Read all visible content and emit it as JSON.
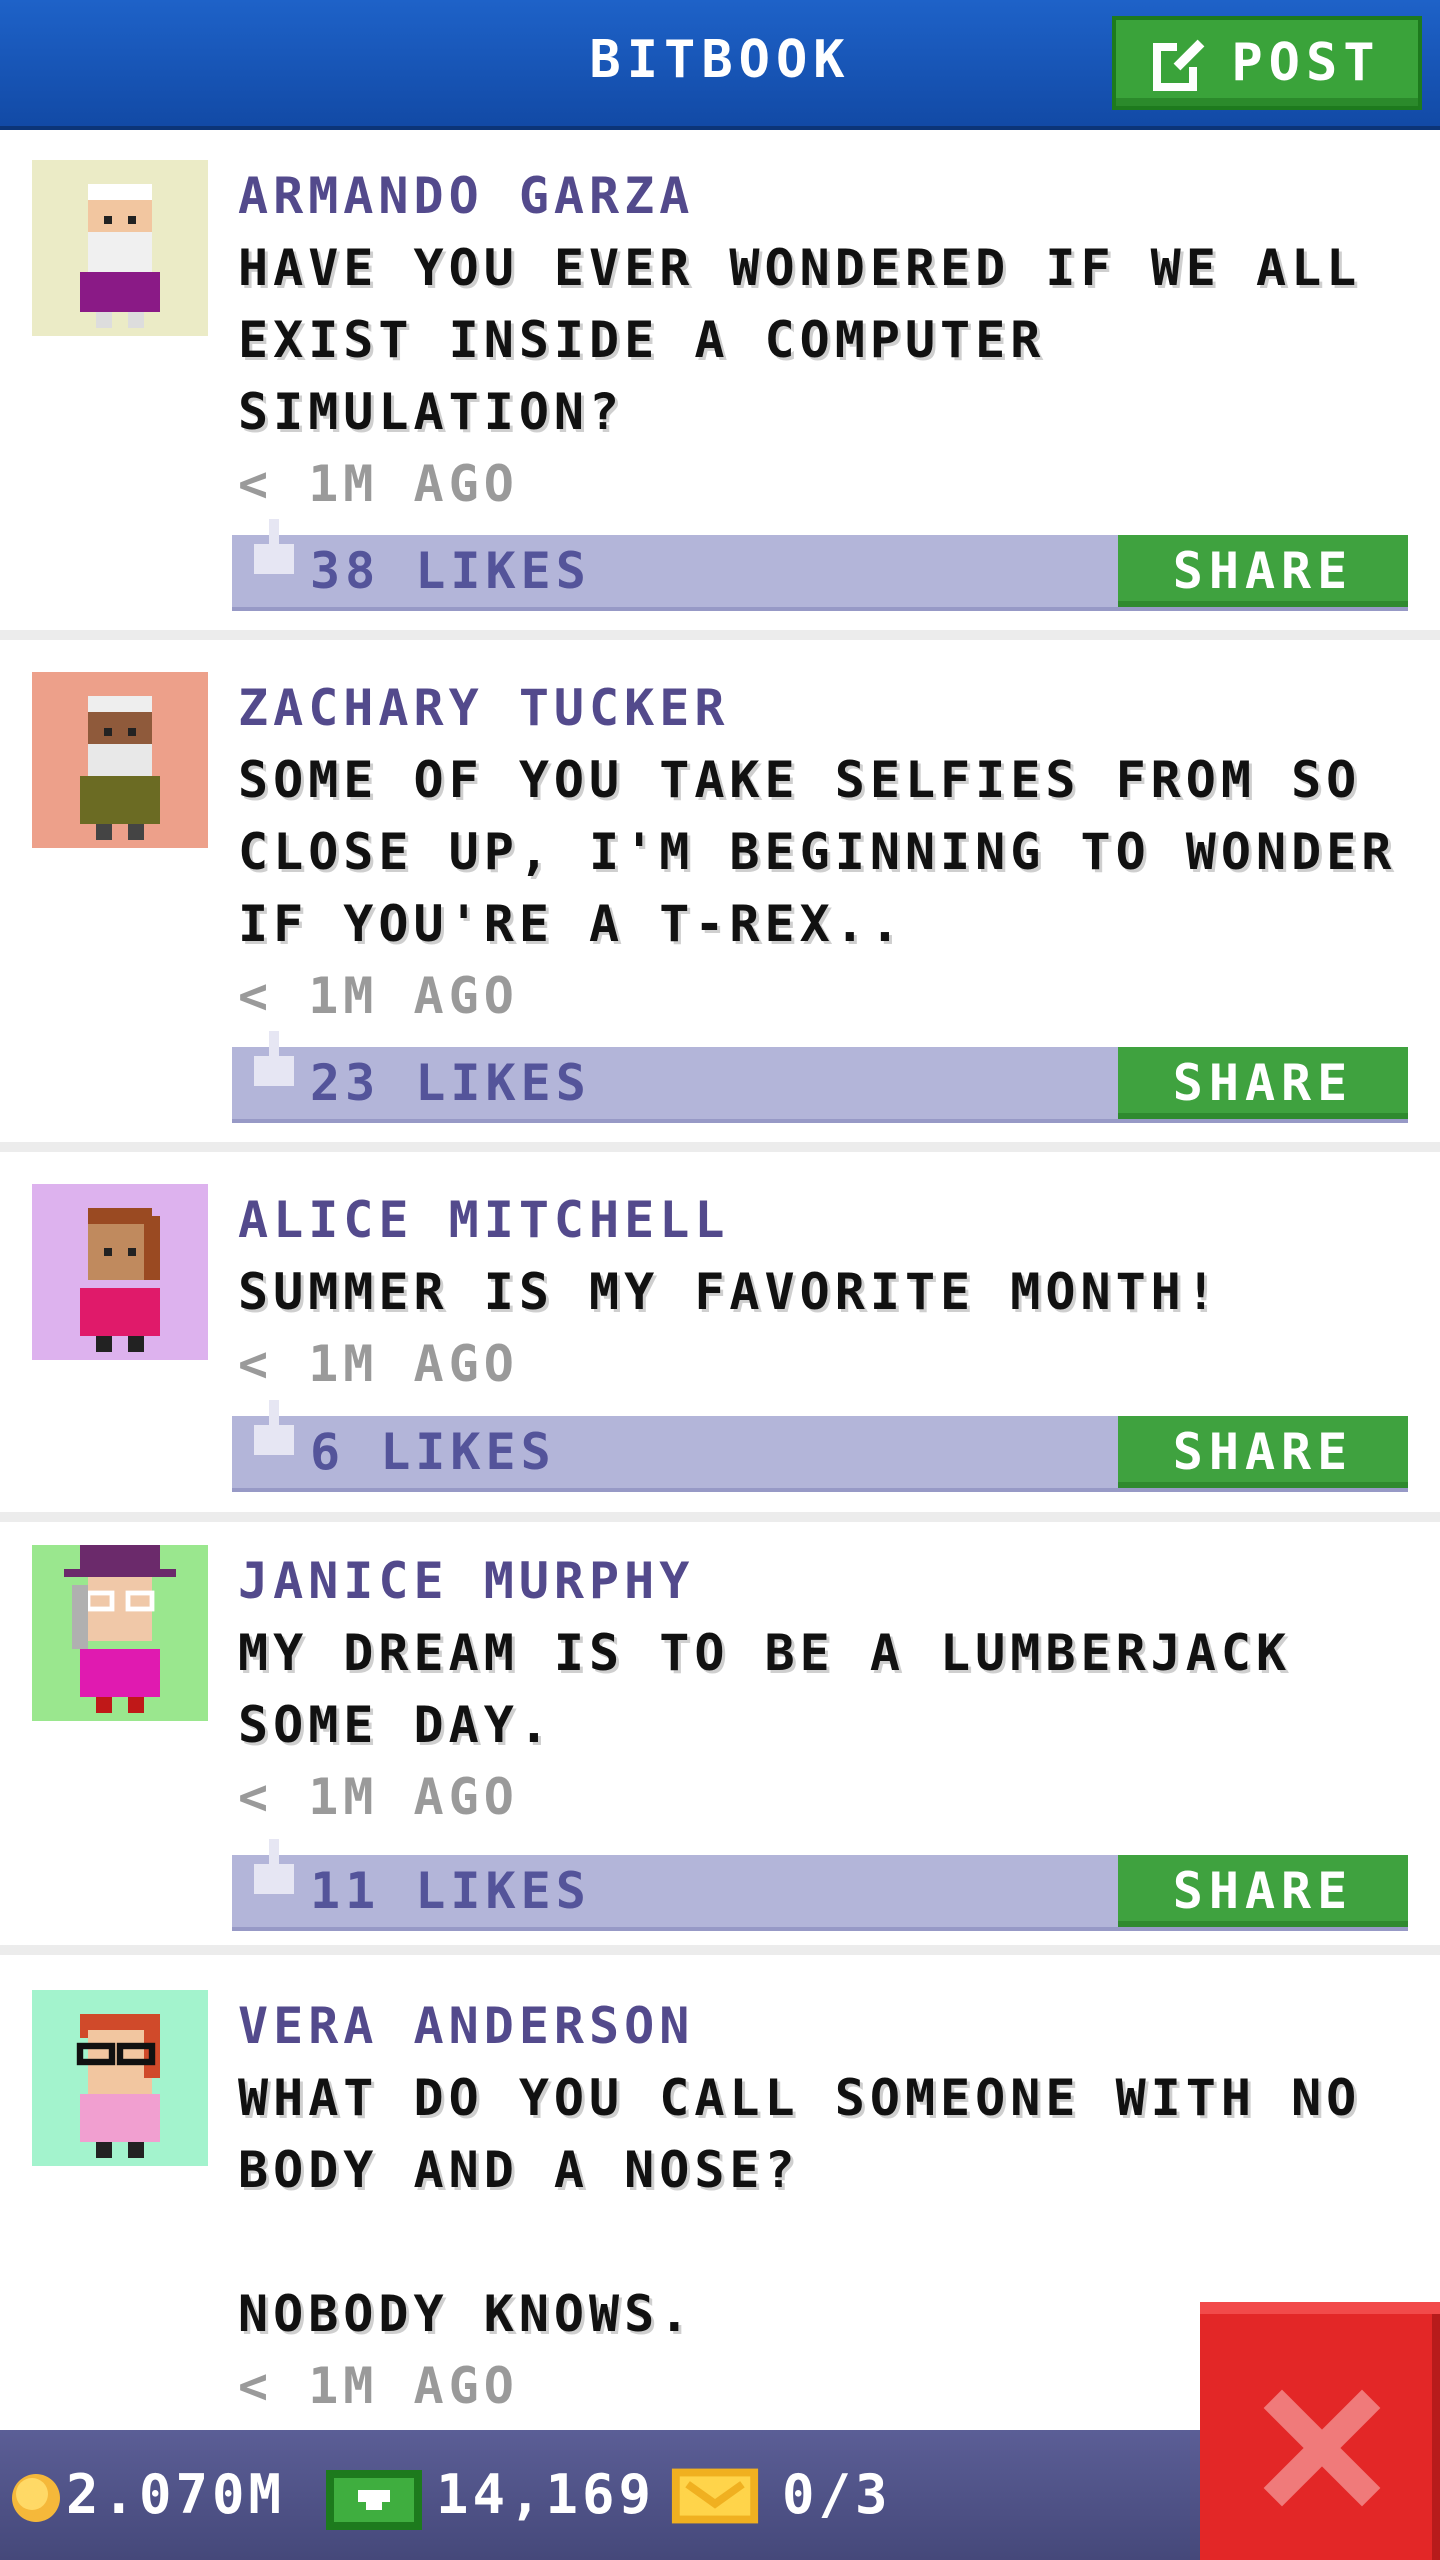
{
  "header": {
    "title": "BITBOOK",
    "post_label": "POST"
  },
  "colors": {
    "header_blue": "#1a58bb",
    "accent_green": "#3fa23f",
    "author_purple": "#534a8c",
    "likes_bar": "#b3b5d9",
    "close_red": "#e32727"
  },
  "posts": [
    {
      "author": "ARMANDO GARZA",
      "message": "HAVE YOU EVER WONDERED IF WE ALL\nEXIST INSIDE A COMPUTER\nSIMULATION?",
      "time": "< 1M AGO",
      "likes": "38 LIKES",
      "share": "SHARE",
      "avatar_bg": "#ebebc6"
    },
    {
      "author": "ZACHARY TUCKER",
      "message": "SOME OF YOU TAKE SELFIES FROM SO\nCLOSE UP, I'M BEGINNING TO WONDER\nIF YOU'RE A T-REX..",
      "time": "< 1M AGO",
      "likes": "23 LIKES",
      "share": "SHARE",
      "avatar_bg": "#eda08a"
    },
    {
      "author": "ALICE MITCHELL",
      "message": "SUMMER IS MY FAVORITE MONTH!",
      "time": "< 1M AGO",
      "likes": "6 LIKES",
      "share": "SHARE",
      "avatar_bg": "#ddb2ee"
    },
    {
      "author": "JANICE MURPHY",
      "message": "MY DREAM IS TO BE A LUMBERJACK\nSOME DAY.",
      "time": "< 1M AGO",
      "likes": "11 LIKES",
      "share": "SHARE",
      "avatar_bg": "#9ae78e"
    },
    {
      "author": "VERA ANDERSON",
      "message": "WHAT DO YOU CALL SOMEONE WITH NO\nBODY AND A NOSE?\n\nNOBODY KNOWS.",
      "time": "< 1M AGO",
      "avatar_bg": "#a3f3cd"
    }
  ],
  "footer": {
    "coins": "2.070M",
    "bux": "14,169",
    "tickets": "0/3"
  },
  "icons": {
    "post": "edit-icon",
    "like": "thumbs-up-icon",
    "coin": "coin-icon",
    "bux": "bux-icon",
    "ticket": "ticket-icon",
    "close": "close-icon"
  }
}
